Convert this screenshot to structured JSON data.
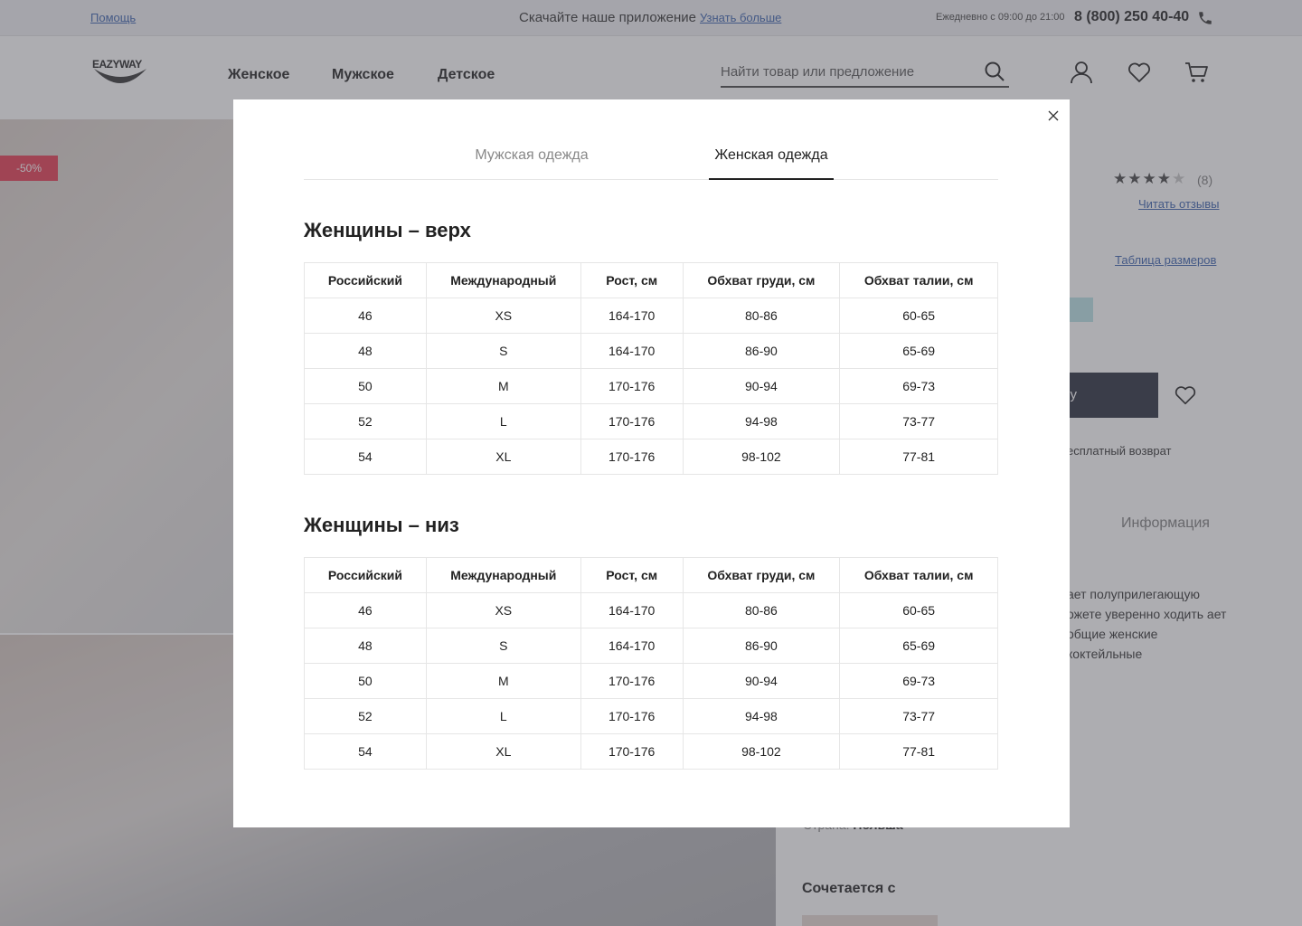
{
  "topbar": {
    "help_label": "Помощь",
    "promo_text": "Скачайте наше приложение",
    "promo_link": "Узнать больше",
    "hours": "Ежедневно с 09:00 до 21:00",
    "phone": "8 (800) 250 40-40"
  },
  "header": {
    "logo_text": "EAZYWAY",
    "nav": [
      "Женское",
      "Мужское",
      "Детское"
    ],
    "search_placeholder": "Найти товар или предложение"
  },
  "product": {
    "sale_badge": "-50%",
    "rating": 4,
    "rating_max": 5,
    "reviews_count": "(8)",
    "reviews_link": "Читать отзывы",
    "size_table_link": "Таблица размеров",
    "free_return": "есплатный возврат",
    "info_tab": "Информация",
    "description": "ает полуприлегающую ожете уверенно ходить ает общие женские коктейльные",
    "country_label": "Страна:",
    "country_value": "Польша",
    "combines_title": "Сочетается с"
  },
  "modal": {
    "tabs": [
      "Мужская одежда",
      "Женская одежда"
    ],
    "active_tab": "Женская одежда",
    "columns": [
      "Российский",
      "Международный",
      "Рост, см",
      "Обхват груди, см",
      "Обхват талии, см"
    ],
    "sections": [
      {
        "title": "Женщины – верх",
        "rows": [
          [
            "46",
            "XS",
            "164-170",
            "80-86",
            "60-65"
          ],
          [
            "48",
            "S",
            "164-170",
            "86-90",
            "65-69"
          ],
          [
            "50",
            "M",
            "170-176",
            "90-94",
            "69-73"
          ],
          [
            "52",
            "L",
            "170-176",
            "94-98",
            "73-77"
          ],
          [
            "54",
            "XL",
            "170-176",
            "98-102",
            "77-81"
          ]
        ]
      },
      {
        "title": "Женщины – низ",
        "rows": [
          [
            "46",
            "XS",
            "164-170",
            "80-86",
            "60-65"
          ],
          [
            "48",
            "S",
            "164-170",
            "86-90",
            "65-69"
          ],
          [
            "50",
            "M",
            "170-176",
            "90-94",
            "69-73"
          ],
          [
            "52",
            "L",
            "170-176",
            "94-98",
            "73-77"
          ],
          [
            "54",
            "XL",
            "170-176",
            "98-102",
            "77-81"
          ]
        ]
      }
    ]
  },
  "icons": {
    "phone": "phone-icon",
    "search": "search-icon",
    "user": "user-icon",
    "heart": "heart-icon",
    "cart": "cart-icon",
    "close": "close-icon"
  }
}
